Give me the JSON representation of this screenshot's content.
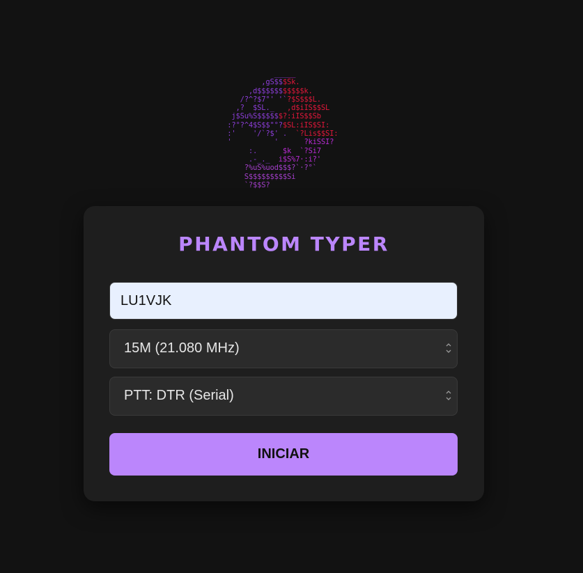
{
  "logo": {
    "lines": [
      [
        {
          "c": "p",
          "t": "             ___"
        },
        {
          "c": "m",
          "t": "__"
        }
      ],
      [
        {
          "c": "p",
          "t": "          ,gS$$"
        },
        {
          "c": "r",
          "t": "$Sk."
        }
      ],
      [
        {
          "c": "p",
          "t": "       ,d$$$$$$"
        },
        {
          "c": "r",
          "t": "$$$$$k."
        }
      ],
      [
        {
          "c": "p",
          "t": "     /?^?$7°' '`"
        },
        {
          "c": "r",
          "t": "?$S$$$L."
        }
      ],
      [
        {
          "c": "p",
          "t": "    ,?  $SL._   "
        },
        {
          "c": "r",
          "t": ",d$iIS$$SL"
        }
      ],
      [
        {
          "c": "p",
          "t": "   j$Su%S$$$$$"
        },
        {
          "c": "r",
          "t": "$?:iIS$$Sb"
        }
      ],
      [
        {
          "c": "p",
          "t": "  :?°?^4$S$$\"°?"
        },
        {
          "c": "r",
          "t": "$SL:iIS$SI:"
        }
      ],
      [
        {
          "c": "p",
          "t": "  :'    '/`?$' .  "
        },
        {
          "c": "r",
          "t": "`?Lis$$SI:"
        }
      ],
      [
        {
          "c": "p",
          "t": "  '          '      "
        },
        {
          "c": "m",
          "t": "?kiSSI?"
        }
      ],
      [
        {
          "c": "p",
          "t": "       :.      "
        },
        {
          "c": "m",
          "t": "$k  `?Si7"
        }
      ],
      [
        {
          "c": "p",
          "t": "       .-_._  "
        },
        {
          "c": "m",
          "t": "i$S%7·:i?'"
        }
      ],
      [
        {
          "c": "v",
          "t": "      ?%uS%uod$$$?`·?°`"
        }
      ],
      [
        {
          "c": "v",
          "t": "      S$$$$$$$$$Si"
        }
      ],
      [
        {
          "c": "v",
          "t": "      `?$$S?"
        }
      ]
    ]
  },
  "app": {
    "title": "PHANTOM TYPER"
  },
  "form": {
    "callsign_value": "LU1VJK",
    "band_selected": "15M (21.080 MHz)",
    "ptt_selected": "PTT: DTR (Serial)",
    "start_label": "INICIAR"
  },
  "colors": {
    "accent": "#bb86fc",
    "background": "#121212",
    "card": "#1e1e1e",
    "field": "#2b2b2b",
    "input_fill": "#e8f0fe"
  },
  "icons": {
    "select_arrow": "chevron-updown-icon"
  }
}
